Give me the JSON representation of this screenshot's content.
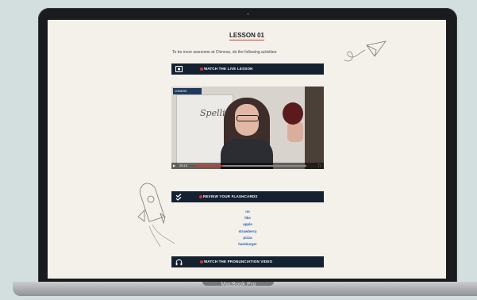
{
  "device": {
    "brand": "MacBook Pro"
  },
  "lesson": {
    "title": "LESSON 01",
    "intro": "To be more awesome at Chinese, do the following activities:"
  },
  "sections": [
    {
      "label": "WATCH THE LIVE LESSON",
      "icon": "video-icon"
    },
    {
      "label": "REVIEW YOUR FLASHCARDS",
      "icon": "check-icon"
    },
    {
      "label": "WATCH THE PRONUNCIATION VIDEO",
      "icon": "headphones-icon"
    }
  ],
  "video": {
    "board_text": "Spelling Bee",
    "logo": "CHINESE",
    "time": "05:18",
    "progress": 0.25
  },
  "flashcards": [
    "no",
    "like",
    "apple",
    "strawberry",
    "pizza",
    "hamburger"
  ],
  "colors": {
    "bar": "#142131",
    "accent": "#d9342b",
    "link": "#2a62b5",
    "page": "#f4f1eb"
  }
}
